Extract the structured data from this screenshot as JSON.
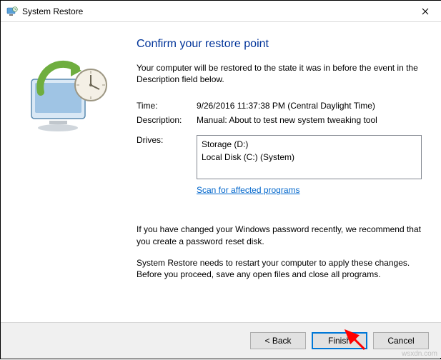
{
  "window": {
    "title": "System Restore"
  },
  "main": {
    "heading": "Confirm your restore point",
    "intro": "Your computer will be restored to the state it was in before the event in the Description field below.",
    "time_label": "Time:",
    "time_value": "9/26/2016 11:37:38 PM (Central Daylight Time)",
    "desc_label": "Description:",
    "desc_value": "Manual: About to test new system tweaking tool",
    "drives_label": "Drives:",
    "drives": [
      "Storage (D:)",
      "Local Disk (C:) (System)"
    ],
    "scan_link": "Scan for affected programs",
    "password_note": "If you have changed your Windows password recently, we recommend that you create a password reset disk.",
    "restart_note": "System Restore needs to restart your computer to apply these changes. Before you proceed, save any open files and close all programs."
  },
  "buttons": {
    "back": "< Back",
    "finish": "Finish",
    "cancel": "Cancel"
  },
  "watermark": "wsxdn.com"
}
